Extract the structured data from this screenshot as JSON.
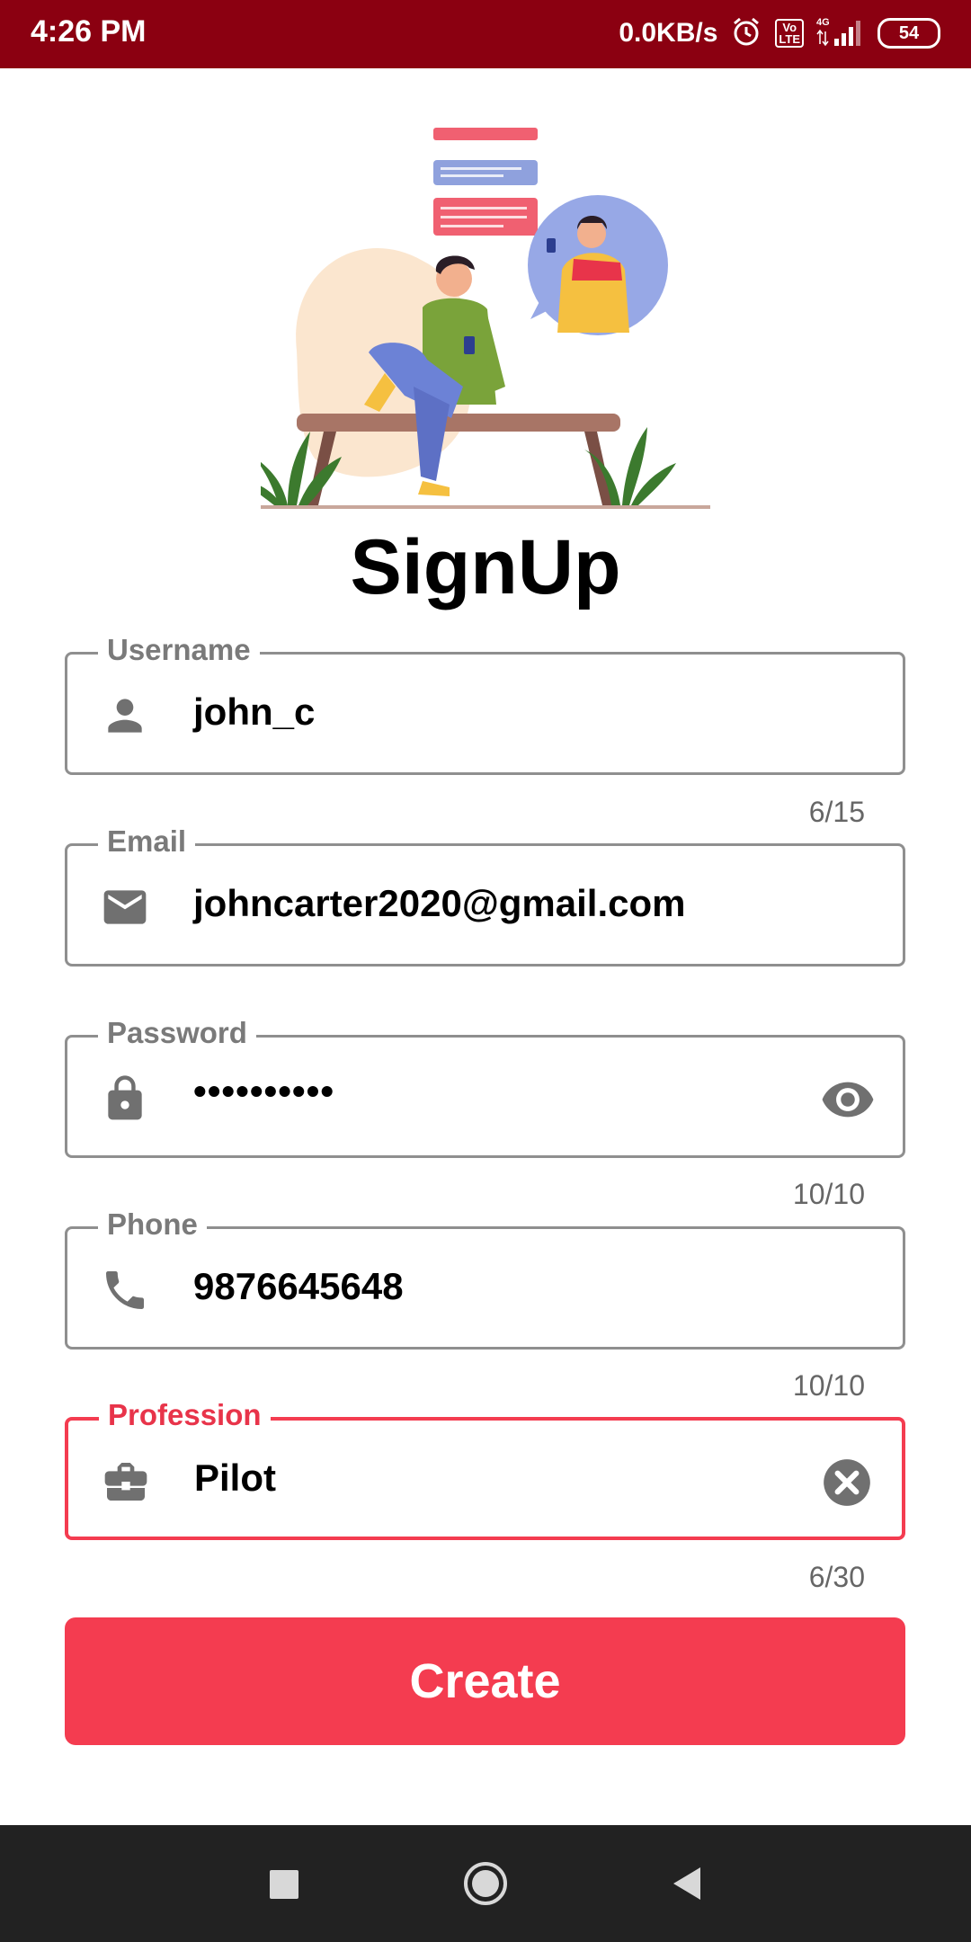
{
  "status_bar": {
    "time": "4:26 PM",
    "net_speed": "0.0KB/s",
    "volte": "Vo LTE",
    "network": "4G",
    "battery": "54"
  },
  "page": {
    "title": "SignUp"
  },
  "fields": {
    "username": {
      "label": "Username",
      "value": "john_c",
      "counter": "6/15",
      "icon": "person-icon"
    },
    "email": {
      "label": "Email",
      "value": "johncarter2020@gmail.com",
      "icon": "mail-icon"
    },
    "password": {
      "label": "Password",
      "value": "••••••••••",
      "counter": "10/10",
      "icon": "lock-icon",
      "trailing_icon": "eye-icon"
    },
    "phone": {
      "label": "Phone",
      "value": "9876645648",
      "counter": "10/10",
      "icon": "phone-icon"
    },
    "profession": {
      "label": "Profession",
      "value": "Pilot",
      "counter": "6/30",
      "icon": "briefcase-icon",
      "trailing_icon": "clear-icon"
    }
  },
  "create_button": {
    "label": "Create"
  },
  "colors": {
    "status_bar": "#8b0011",
    "accent": "#f43c50",
    "outline": "#8f8f8f",
    "label": "#7a7a7a",
    "nav_bar": "#222222"
  },
  "nav": {
    "recents_icon": "square-icon",
    "home_icon": "circle-icon",
    "back_icon": "triangle-back-icon"
  }
}
